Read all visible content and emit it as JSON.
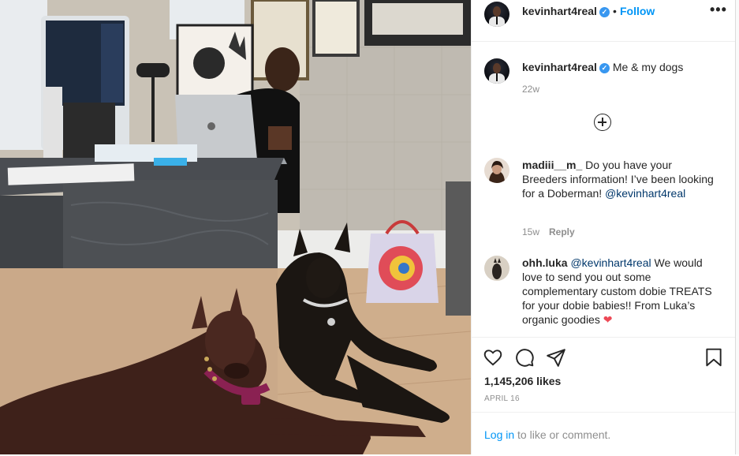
{
  "post": {
    "author": "kevinhart4real",
    "follow_label": "Follow",
    "dot": "•",
    "more_label": "•••",
    "caption": "Me & my dogs",
    "caption_age": "22w",
    "likes": "1,145,206 likes",
    "date": "APRIL 16"
  },
  "comments": [
    {
      "user": "madiii__m_",
      "text": "Do you have your Breeders information! I’ve been looking for a Doberman!",
      "mention": "@kevinhart4real",
      "age": "15w",
      "reply_label": "Reply"
    },
    {
      "user": "ohh.luka",
      "mention": "@kevinhart4real",
      "text": "We would love to send you out some complementary custom dobie TREATS for your dobie babies!! From Luka’s organic goodies",
      "emoji": "❤"
    }
  ],
  "login": {
    "link_label": "Log in",
    "rest": "to like or comment."
  },
  "icons": {
    "verified": "✓",
    "like": "heart-icon",
    "comment": "comment-icon",
    "share": "share-icon",
    "save": "bookmark-icon"
  },
  "colors": {
    "accent": "#0095f6",
    "verified": "#3897f0",
    "heart": "#ed4956",
    "muted": "#8e8e8e"
  }
}
